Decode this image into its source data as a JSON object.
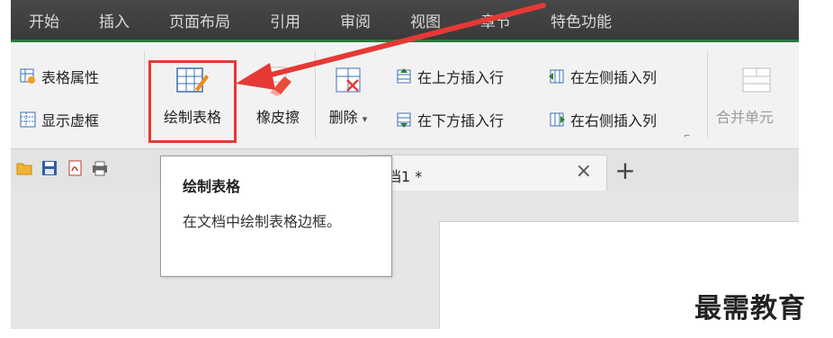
{
  "menu": {
    "items": [
      "开始",
      "插入",
      "页面布局",
      "引用",
      "审阅",
      "视图",
      "章节",
      "特色功能"
    ],
    "active_underline_color": "#2c7a3e"
  },
  "ribbon": {
    "table_properties": "表格属性",
    "show_gridlines": "显示虚框",
    "draw_table": "绘制表格",
    "eraser": "橡皮擦",
    "delete": "删除",
    "insert_row_above": "在上方插入行",
    "insert_row_below": "在下方插入行",
    "insert_col_left": "在左侧插入列",
    "insert_col_right": "在右侧插入列",
    "merge_cells": "合并单元",
    "dropdown_glyph": "▾",
    "launcher_glyph": "⌐"
  },
  "tabs": {
    "doc_title": "档1 *",
    "close_glyph": "×",
    "add_glyph": "+"
  },
  "tooltip": {
    "title": "绘制表格",
    "description": "在文档中绘制表格边框。"
  },
  "watermark": "最需教育",
  "colors": {
    "highlight_red": "#e53935",
    "menu_bg": "#404040"
  },
  "icons": [
    "table-properties-icon",
    "show-gridlines-icon",
    "draw-table-icon",
    "eraser-icon",
    "delete-table-icon",
    "insert-row-above-icon",
    "insert-row-below-icon",
    "insert-col-left-icon",
    "insert-col-right-icon",
    "merge-cells-icon",
    "open-folder-icon",
    "save-icon",
    "pdf-export-icon",
    "print-icon"
  ]
}
